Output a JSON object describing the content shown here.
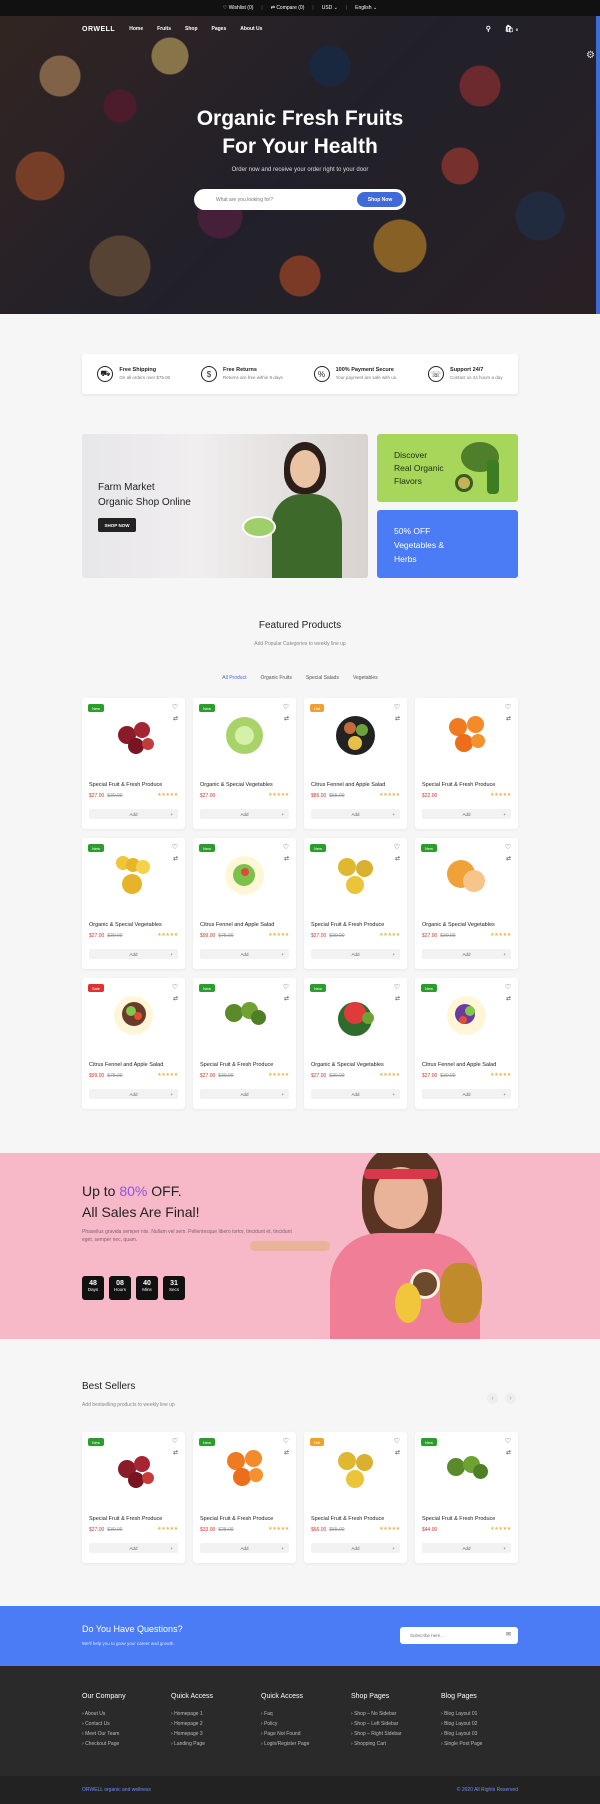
{
  "topbar": {
    "wishlist": "♡ Wishlist (0)",
    "compare": "⇄ Compare (0)",
    "currency": "USD",
    "language": "English"
  },
  "nav": {
    "logo": "ORWELL",
    "links": [
      "Home",
      "Fruits",
      "Shop",
      "Pages",
      "About Us"
    ],
    "cart_count": "0"
  },
  "hero": {
    "title_line1": "Organic Fresh Fruits",
    "title_line2": "For Your Health",
    "subtitle": "Order now and receive your order right to your door",
    "search_placeholder": "What are you looking for?",
    "search_button": "Shop Now"
  },
  "features": [
    {
      "icon": "truck-icon",
      "title": "Free Shipping",
      "text": "On all orders over $75.00"
    },
    {
      "icon": "return-icon",
      "title": "Free Returns",
      "text": "Returns are free within 9 days"
    },
    {
      "icon": "percent-icon",
      "title": "100% Payment Secure",
      "text": "Your payment are safe with us."
    },
    {
      "icon": "headset-icon",
      "title": "Support 24/7",
      "text": "Contact us 24 hours a day"
    }
  ],
  "banners": {
    "main_line1": "Farm Market",
    "main_line2": "Organic Shop Online",
    "main_button": "SHOP NOW",
    "green_line1": "Discover",
    "green_line2": "Real Organic",
    "green_line3": "Flavors",
    "blue_line1": "50% OFF",
    "blue_line2": "Vegetables &",
    "blue_line3": "Herbs"
  },
  "featured": {
    "title": "Featured Products",
    "subtitle": "Add Popular Categories to weekly line up",
    "tabs": [
      "All Product",
      "Organic Fruits",
      "Special Salads",
      "Vegetables"
    ]
  },
  "products": [
    {
      "badge": "New",
      "badge_color": "#2a9d2a",
      "name": "Special Fruit & Fresh Produce",
      "price": "$27.00",
      "old": "$30.00",
      "img": "apples"
    },
    {
      "badge": "New",
      "badge_color": "#2a9d2a",
      "name": "Organic & Special Vegetables",
      "price": "$27.00",
      "old": "",
      "img": "cabbage"
    },
    {
      "badge": "Hot",
      "badge_color": "#f0a030",
      "name": "Citrus Fennel and Apple Salad",
      "price": "$86.00",
      "old": "$55.00",
      "img": "bowl"
    },
    {
      "badge": "",
      "badge_color": "",
      "name": "Special Fruit & Fresh Produce",
      "price": "$22.00",
      "old": "",
      "img": "oranges"
    },
    {
      "badge": "New",
      "badge_color": "#2a9d2a",
      "name": "Organic & Special Vegetables",
      "price": "$27.00",
      "old": "$30.00",
      "img": "bananas"
    },
    {
      "badge": "New",
      "badge_color": "#2a9d2a",
      "name": "Citrus Fennel and Apple Salad",
      "price": "$99.00",
      "old": "$75.00",
      "img": "salad"
    },
    {
      "badge": "New",
      "badge_color": "#2a9d2a",
      "name": "Special Fruit & Fresh Produce",
      "price": "$27.00",
      "old": "$30.00",
      "img": "yellow"
    },
    {
      "badge": "New",
      "badge_color": "#2a9d2a",
      "name": "Organic & Special Vegetables",
      "price": "$27.00",
      "old": "$30.00",
      "img": "melon"
    },
    {
      "badge": "Sale",
      "badge_color": "#e03030",
      "name": "Citrus Fennel and Apple Salad",
      "price": "$99.00",
      "old": "$75.00",
      "img": "bowl2"
    },
    {
      "badge": "New",
      "badge_color": "#2a9d2a",
      "name": "Special Fruit & Fresh Produce",
      "price": "$27.00",
      "old": "$30.00",
      "img": "limes"
    },
    {
      "badge": "New",
      "badge_color": "#2a9d2a",
      "name": "Organic & Special Vegetables",
      "price": "$27.00",
      "old": "$30.00",
      "img": "watermelon"
    },
    {
      "badge": "New",
      "badge_color": "#2a9d2a",
      "name": "Citrus Fennel and Apple Salad",
      "price": "$27.00",
      "old": "$30.00",
      "img": "bowl3"
    }
  ],
  "promo": {
    "line1_pre": "Up to ",
    "line1_pct": "80%",
    "line1_post": " OFF.",
    "line2": "All Sales Are Final!",
    "text": "Phasellus gravida semper nisi. Nullam vel sem. Pellentesque libero tortor, tincidunt et, tincidunt eget, semper nec, quam.",
    "countdown": [
      {
        "value": "48",
        "label": "Days"
      },
      {
        "value": "08",
        "label": "Hours"
      },
      {
        "value": "40",
        "label": "Mins"
      },
      {
        "value": "31",
        "label": "Secs"
      }
    ]
  },
  "bestsellers": {
    "title": "Best Sellers",
    "subtitle": "Add bestselling products to weekly line up",
    "items": [
      {
        "badge": "New",
        "badge_color": "#2a9d2a",
        "name": "Special Fruit & Fresh Produce",
        "price": "$27.00",
        "old": "$30.00",
        "img": "apples"
      },
      {
        "badge": "New",
        "badge_color": "#2a9d2a",
        "name": "Special Fruit & Fresh Produce",
        "price": "$33.00",
        "old": "$28.00",
        "img": "oranges"
      },
      {
        "badge": "Hot",
        "badge_color": "#f0a030",
        "name": "Special Fruit & Fresh Produce",
        "price": "$66.00",
        "old": "$55.00",
        "img": "yellow"
      },
      {
        "badge": "New",
        "badge_color": "#2a9d2a",
        "name": "Special Fruit & Fresh Produce",
        "price": "$44.00",
        "old": "",
        "img": "limes"
      }
    ]
  },
  "product_ui": {
    "add": "Add",
    "stars": "★★★★★"
  },
  "newsletter": {
    "title": "Do You Have Questions?",
    "subtitle": "We'll help you to grow your career and growth.",
    "placeholder": "Subscribe here..."
  },
  "footer": {
    "columns": [
      {
        "title": "Our Company",
        "items": [
          "About Us",
          "Contact Us",
          "Meet Our Team",
          "Checkout Page"
        ]
      },
      {
        "title": "Quick Access",
        "items": [
          "Homepage 1",
          "Homepage 2",
          "Homepage 3",
          "Landing Page"
        ]
      },
      {
        "title": "Quick Access",
        "items": [
          "Faq",
          "Policy",
          "Page Not Found",
          "Login/Register Page"
        ]
      },
      {
        "title": "Shop Pages",
        "items": [
          "Shop – No Sidebar",
          "Shop – Left Sidebar",
          "Shop – Right Sidebar",
          "Shopping Cart"
        ]
      },
      {
        "title": "Blog Pages",
        "items": [
          "Blog Layout 01",
          "Blog Layout 02",
          "Blog Layout 03",
          "Single Post Page"
        ]
      }
    ],
    "bottom_left": "ORWELL organic and wellness",
    "bottom_right": "© 2020 All Rights Reserved"
  },
  "colors": {
    "accent": "#3f6ad8",
    "green": "#a6d65a",
    "promo_bg": "#f7b9c8",
    "footer_bg": "#2a2a2a"
  }
}
